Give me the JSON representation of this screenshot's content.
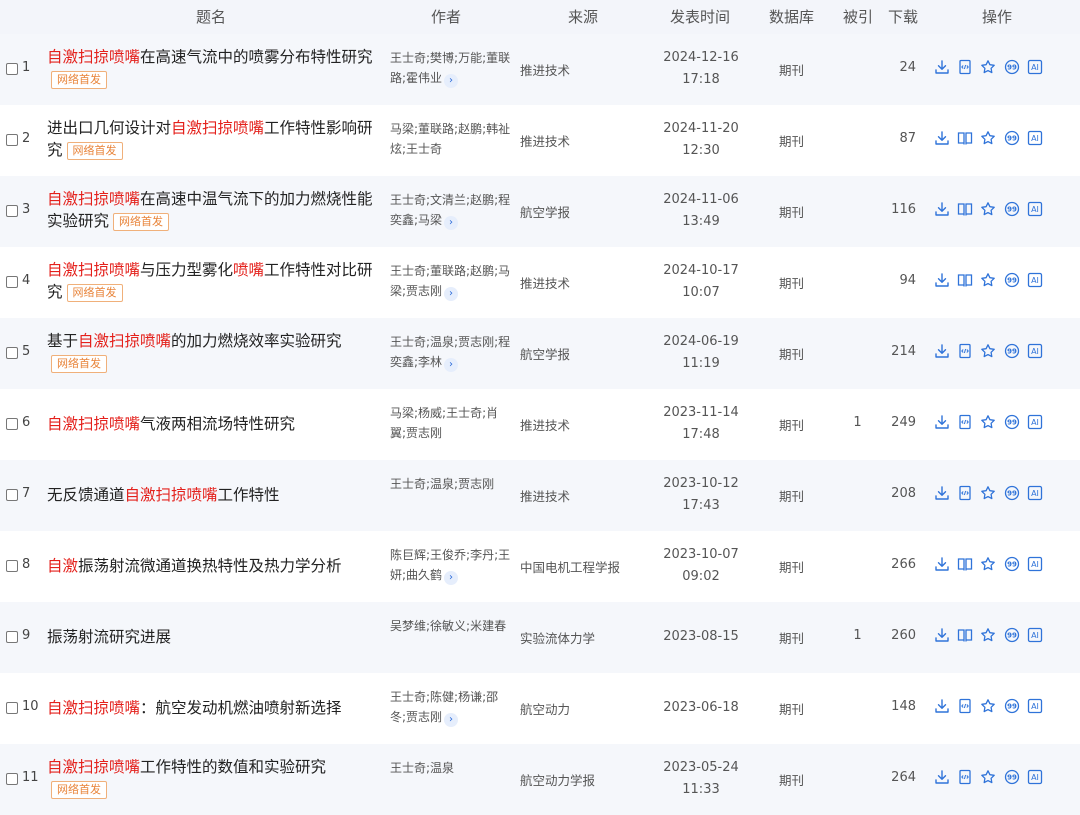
{
  "colors": {
    "highlight": "#e4211c",
    "badge": "#e8843a",
    "icon": "#2f73d9",
    "alt_row": "#f5f7fb",
    "header_bg": "#f3f5fa"
  },
  "header": {
    "title": "题名",
    "author": "作者",
    "source": "来源",
    "date": "发表时间",
    "db": "数据库",
    "cited": "被引",
    "downloads": "下载",
    "actions": "操作"
  },
  "badge_label": "网络首发",
  "rows": [
    {
      "num": "1",
      "title_segments": [
        {
          "t": "自激扫掠喷嘴",
          "hl": true
        },
        {
          "t": "在高速气流中的喷雾分布特性研究",
          "hl": false
        }
      ],
      "badge": true,
      "authors": "王士奇;樊博;万能;董联路;霍伟业",
      "more": true,
      "source": "推进技术",
      "date": [
        "2024-12-16",
        "17:18"
      ],
      "db": "期刊",
      "cited": "",
      "downloads": "24",
      "read_icon": "html"
    },
    {
      "num": "2",
      "title_segments": [
        {
          "t": "进出口几何设计对",
          "hl": false
        },
        {
          "t": "自激扫掠喷嘴",
          "hl": true
        },
        {
          "t": "工作特性影响研究",
          "hl": false
        }
      ],
      "badge": true,
      "authors": "马梁;董联路;赵鹏;韩祉炫;王士奇",
      "more": false,
      "source": "推进技术",
      "date": [
        "2024-11-20",
        "12:30"
      ],
      "db": "期刊",
      "cited": "",
      "downloads": "87",
      "read_icon": "book"
    },
    {
      "num": "3",
      "title_segments": [
        {
          "t": "自激扫掠喷嘴",
          "hl": true
        },
        {
          "t": "在高速中温气流下的加力燃烧性能实验研究",
          "hl": false
        }
      ],
      "badge": true,
      "authors": "王士奇;文清兰;赵鹏;程奕鑫;马梁",
      "more": true,
      "source": "航空学报",
      "date": [
        "2024-11-06",
        "13:49"
      ],
      "db": "期刊",
      "cited": "",
      "downloads": "116",
      "read_icon": "book"
    },
    {
      "num": "4",
      "title_segments": [
        {
          "t": "自激扫掠喷嘴",
          "hl": true
        },
        {
          "t": "与压力型雾化",
          "hl": false
        },
        {
          "t": "喷嘴",
          "hl": true
        },
        {
          "t": "工作特性对比研究",
          "hl": false
        }
      ],
      "badge": true,
      "authors": "王士奇;董联路;赵鹏;马梁;贾志刚",
      "more": true,
      "source": "推进技术",
      "date": [
        "2024-10-17",
        "10:07"
      ],
      "db": "期刊",
      "cited": "",
      "downloads": "94",
      "read_icon": "book"
    },
    {
      "num": "5",
      "title_segments": [
        {
          "t": "基于",
          "hl": false
        },
        {
          "t": "自激扫掠喷嘴",
          "hl": true
        },
        {
          "t": "的加力燃烧效率实验研究",
          "hl": false
        }
      ],
      "badge": true,
      "authors": "王士奇;温泉;贾志刚;程奕鑫;李林",
      "more": true,
      "source": "航空学报",
      "date": [
        "2024-06-19",
        "11:19"
      ],
      "db": "期刊",
      "cited": "",
      "downloads": "214",
      "read_icon": "html"
    },
    {
      "num": "6",
      "title_segments": [
        {
          "t": "自激扫掠喷嘴",
          "hl": true
        },
        {
          "t": "气液两相流场特性研究",
          "hl": false
        }
      ],
      "badge": false,
      "authors": "马梁;杨威;王士奇;肖翼;贾志刚",
      "more": false,
      "source": "推进技术",
      "date": [
        "2023-11-14",
        "17:48"
      ],
      "db": "期刊",
      "cited": "1",
      "downloads": "249",
      "read_icon": "html"
    },
    {
      "num": "7",
      "title_segments": [
        {
          "t": "无反馈通道",
          "hl": false
        },
        {
          "t": "自激扫掠喷嘴",
          "hl": true
        },
        {
          "t": "工作特性",
          "hl": false
        }
      ],
      "badge": false,
      "authors": "王士奇;温泉;贾志刚",
      "more": false,
      "source": "推进技术",
      "date": [
        "2023-10-12",
        "17:43"
      ],
      "db": "期刊",
      "cited": "",
      "downloads": "208",
      "read_icon": "html"
    },
    {
      "num": "8",
      "title_segments": [
        {
          "t": "自激",
          "hl": true
        },
        {
          "t": "振荡射流微通道换热特性及热力学分析",
          "hl": false
        }
      ],
      "badge": false,
      "authors": "陈巨辉;王俊乔;李丹;王妍;曲久鹤",
      "more": true,
      "source": "中国电机工程学报",
      "date": [
        "2023-10-07",
        "09:02"
      ],
      "db": "期刊",
      "cited": "",
      "downloads": "266",
      "read_icon": "book"
    },
    {
      "num": "9",
      "title_segments": [
        {
          "t": "振荡射流研究进展",
          "hl": false
        }
      ],
      "badge": false,
      "authors": "吴梦维;徐敏义;米建春",
      "more": false,
      "source": "实验流体力学",
      "date": [
        "2023-08-15"
      ],
      "db": "期刊",
      "cited": "1",
      "downloads": "260",
      "read_icon": "book"
    },
    {
      "num": "10",
      "title_segments": [
        {
          "t": "自激扫掠喷嘴",
          "hl": true
        },
        {
          "t": "：航空发动机燃油喷射新选择",
          "hl": false
        }
      ],
      "badge": false,
      "authors": "王士奇;陈健;杨谦;邵冬;贾志刚",
      "more": true,
      "source": "航空动力",
      "date": [
        "2023-06-18"
      ],
      "db": "期刊",
      "cited": "",
      "downloads": "148",
      "read_icon": "html"
    },
    {
      "num": "11",
      "title_segments": [
        {
          "t": "自激扫掠喷嘴",
          "hl": true
        },
        {
          "t": "工作特性的数值和实验研究",
          "hl": false
        }
      ],
      "badge": true,
      "authors": "王士奇;温泉",
      "more": false,
      "source": "航空动力学报",
      "date": [
        "2023-05-24",
        "11:33"
      ],
      "db": "期刊",
      "cited": "",
      "downloads": "264",
      "read_icon": "html"
    }
  ]
}
